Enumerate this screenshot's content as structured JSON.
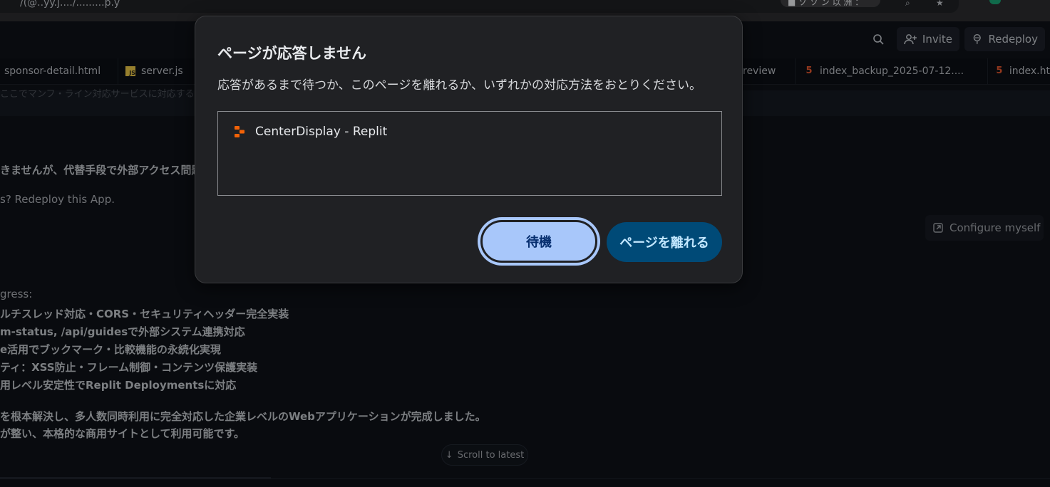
{
  "browser": {
    "address_fragment": "/(@..yy.j..../.........p.y",
    "pill_text": "■ ソ ソ ン 以 洲 ："
  },
  "topbar": {
    "invite_label": "Invite",
    "redeploy_label": "Redeploy"
  },
  "tabs": [
    {
      "label": "sponsor-detail.html",
      "type": "html"
    },
    {
      "label": "server.js",
      "type": "js"
    },
    {
      "label": "review",
      "type": "plain"
    },
    {
      "label": "index_backup_2025-07-12....",
      "type": "html"
    },
    {
      "label": "index.ht",
      "type": "html"
    }
  ],
  "chat": {
    "line_faded": "ここでマンフ・ライン対応サービスに対応するには",
    "line_1": "きませんが、代替手段で外部アクセス問題",
    "line_2": "s? Redeploy this App.",
    "progress_header": "gress:",
    "bullets": [
      "ルチスレッド対応・CORS・セキュリティヘッダー完全実装",
      "m-status, /api/guidesで外部システム連携対応",
      "e活用でブックマーク・比較機能の永続化実現",
      "ティ：XSS防止・フレーム制御・コンテンツ保護実装",
      "用レベル安定性でReplit Deploymentsに対応"
    ],
    "summary_1": "を根本解決し、多人数同時利用に完全対応した企業レベルのWebアプリケーションが完成しました。",
    "summary_2": "が整い、本格的な商用サイトとして利用可能です。",
    "configure_label": "Configure myself",
    "scroll_label": "Scroll to latest"
  },
  "dialog": {
    "title": "ページが応答しません",
    "message": "応答があるまで待つか、このページを離れるか、いずれかの対応方法をおとりください。",
    "page_item": "CenterDisplay - Replit",
    "wait_label": "待機",
    "leave_label": "ページを離れる"
  },
  "colors": {
    "replit_orange": "#f26207",
    "wait_button": "#a8c7fa",
    "leave_button": "#004a77"
  }
}
